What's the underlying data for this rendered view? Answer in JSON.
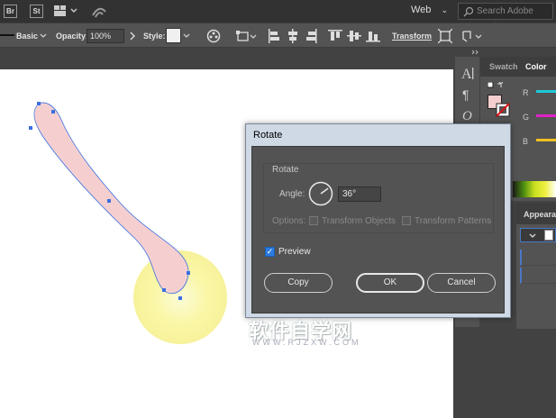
{
  "menubar": {
    "bridge_label": "Br",
    "stock_label": "St",
    "workspace": "Web",
    "search_placeholder": "Search Adobe Stock"
  },
  "controlbar": {
    "stroke_style": "Basic",
    "opacity_label": "Opacity:",
    "opacity_value": "100%",
    "style_label": "Style:",
    "transform_label": "Transform"
  },
  "panels": {
    "swatches_tab": "Swatch",
    "color_tab": "Color",
    "channel_r": "R",
    "channel_g": "G",
    "channel_b": "B",
    "appearance_tab": "Appearan"
  },
  "dialog": {
    "title": "Rotate",
    "group_title": "Rotate",
    "angle_label": "Angle:",
    "angle_value": "36°",
    "angle_fraction": 0.1,
    "options_label": "Options:",
    "transform_objects_label": "Transform Objects",
    "transform_patterns_label": "Transform Patterns",
    "preview_label": "Preview",
    "preview_checked": true,
    "copy_label": "Copy",
    "ok_label": "OK",
    "cancel_label": "Cancel"
  },
  "watermark": {
    "text": "软件自学网",
    "url": "WWW.RJZXW.COM"
  },
  "colors": {
    "shape_fill": "#f5cfd0",
    "glow": "#fbf7a0",
    "selection": "#3b6fe0",
    "channel_r": "#1ec8d8",
    "channel_g": "#e020c8",
    "channel_b": "#f0c020"
  }
}
